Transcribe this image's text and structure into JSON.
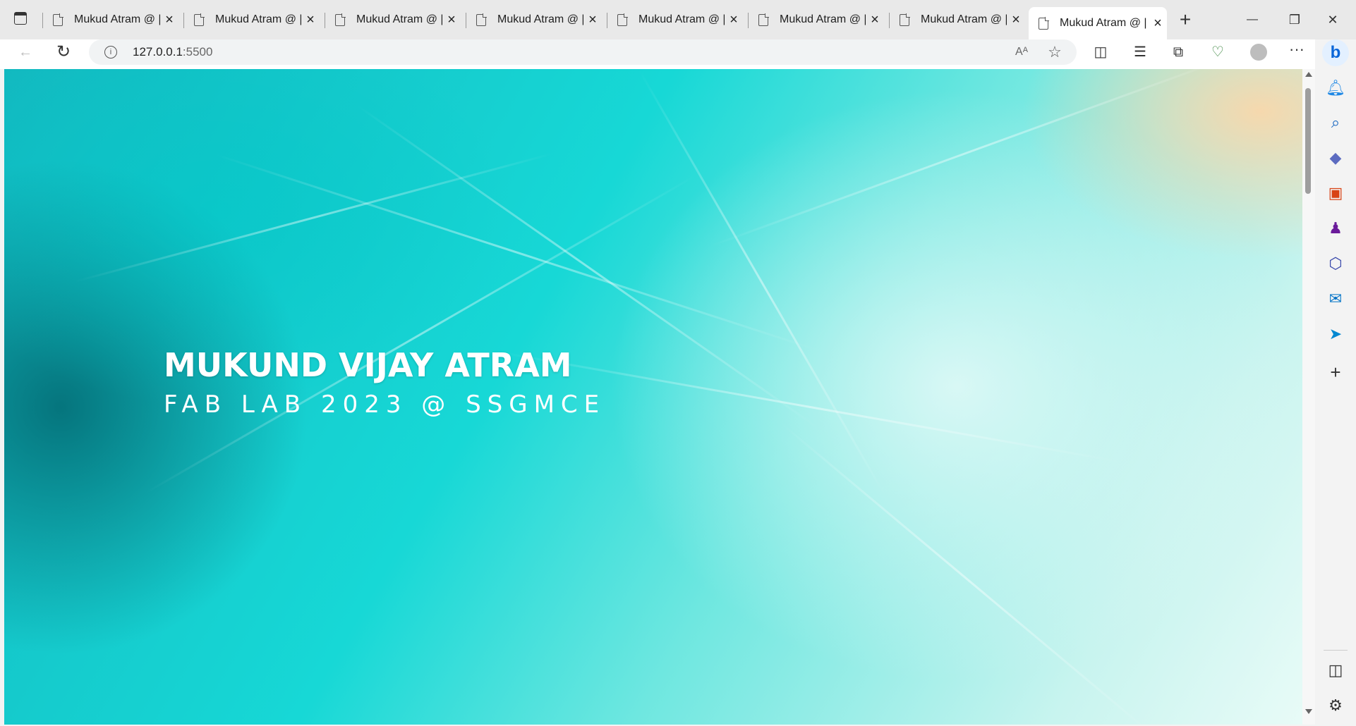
{
  "browser": {
    "tabs": [
      {
        "title": "Mukud Atram @ |"
      },
      {
        "title": "Mukud Atram @ |"
      },
      {
        "title": "Mukud Atram @ |"
      },
      {
        "title": "Mukud Atram @ |"
      },
      {
        "title": "Mukud Atram @ |"
      },
      {
        "title": "Mukud Atram @ |"
      },
      {
        "title": "Mukud Atram @ |"
      },
      {
        "title": "Mukud Atram @ |"
      }
    ],
    "new_tab": "+",
    "address": {
      "host": "127.0.0.1",
      "port": ":5500"
    },
    "window": {
      "minimize": "—",
      "maximize": "❐",
      "close": "✕"
    }
  },
  "page": {
    "name": "MUKUND VIJAY ATRAM",
    "subtitle": "FAB LAB 2023 @ SSGMCE"
  },
  "icons": {
    "sidebar": [
      "bell-icon",
      "search-icon",
      "tag-icon",
      "toolbox-icon",
      "chess-icon",
      "copilot-icon",
      "outlook-icon",
      "send-icon",
      "plus-icon",
      "panel-icon",
      "settings-icon"
    ]
  },
  "colors": {
    "accent": "#17d8d6"
  }
}
